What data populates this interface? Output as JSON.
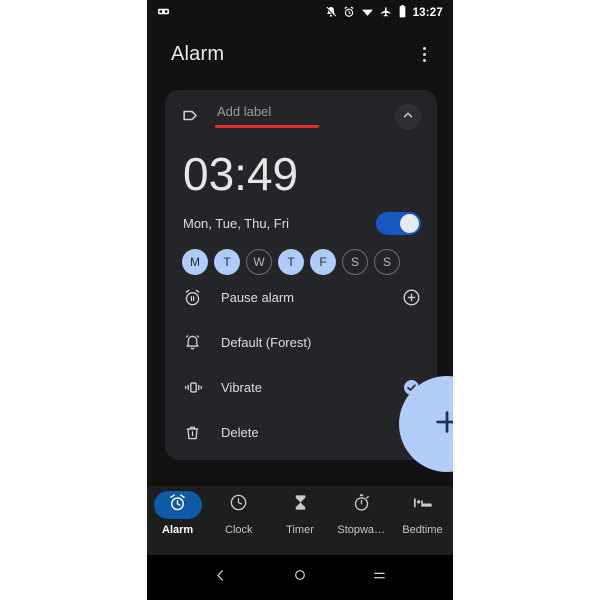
{
  "status_bar": {
    "left_icons": [
      {
        "name": "voicemail-icon"
      }
    ],
    "right_icons": [
      {
        "name": "notifications-muted-icon"
      },
      {
        "name": "alarm-set-icon"
      },
      {
        "name": "wifi-icon"
      },
      {
        "name": "airplane-mode-icon"
      },
      {
        "name": "battery-icon"
      }
    ],
    "clock": "13:27"
  },
  "app_bar": {
    "title": "Alarm",
    "overflow_menu_name": "more-options"
  },
  "alarm_card": {
    "label": {
      "placeholder": "Add label",
      "value": "",
      "underline_color": "#e32b27",
      "icon": "tag-icon"
    },
    "collapse_icon": "chevron-up-icon",
    "time": "03:49",
    "repeat_days_summary": "Mon, Tue, Thu, Fri",
    "enabled": true,
    "toggle_color": "#1658c0",
    "days": [
      {
        "letter": "M",
        "full": "Monday",
        "selected": true
      },
      {
        "letter": "T",
        "full": "Tuesday",
        "selected": true
      },
      {
        "letter": "W",
        "full": "Wednesday",
        "selected": false
      },
      {
        "letter": "T",
        "full": "Thursday",
        "selected": true
      },
      {
        "letter": "F",
        "full": "Friday",
        "selected": true
      },
      {
        "letter": "S",
        "full": "Saturday",
        "selected": false
      },
      {
        "letter": "S",
        "full": "Sunday",
        "selected": false
      }
    ],
    "selected_day_color": "#afcbfa",
    "options": [
      {
        "key": "pause-alarm",
        "label": "Pause alarm",
        "icon": "alarm-pause-icon",
        "trailing": "plus-circle-icon"
      },
      {
        "key": "ringtone",
        "label": "Default (Forest)",
        "icon": "bell-ring-icon",
        "trailing": "none"
      },
      {
        "key": "vibrate",
        "label": "Vibrate",
        "icon": "vibrate-icon",
        "trailing": "checkbox-checked-icon",
        "checked": true
      },
      {
        "key": "delete",
        "label": "Delete",
        "icon": "trash-icon",
        "trailing": "none"
      }
    ]
  },
  "fab": {
    "name": "add-alarm-fab",
    "icon": "plus-icon",
    "color": "#b3cdf8"
  },
  "bottom_nav": {
    "items": [
      {
        "key": "alarm",
        "label": "Alarm",
        "icon": "alarm-clock-icon",
        "active": true
      },
      {
        "key": "clock",
        "label": "Clock",
        "icon": "clock-icon",
        "active": false
      },
      {
        "key": "timer",
        "label": "Timer",
        "icon": "hourglass-icon",
        "active": false
      },
      {
        "key": "stopwatch",
        "label": "Stopwa…",
        "icon": "stopwatch-icon",
        "active": false
      },
      {
        "key": "bedtime",
        "label": "Bedtime",
        "icon": "bed-icon",
        "active": false
      }
    ],
    "active_pill_color": "#0e5aa7"
  },
  "system_nav": {
    "back": "back-icon",
    "home": "home-icon",
    "recents": "recents-icon"
  }
}
